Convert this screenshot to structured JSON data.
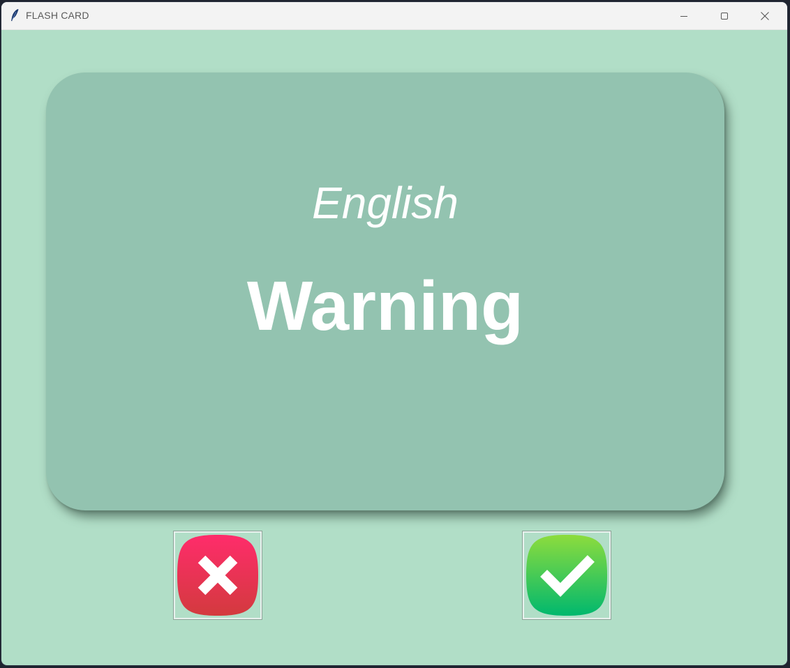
{
  "window": {
    "title": "FLASH CARD"
  },
  "card": {
    "language": "English",
    "word": "Warning"
  },
  "buttons": {
    "wrong_icon": "cross-icon",
    "right_icon": "check-icon"
  },
  "colors": {
    "background": "#b1dec7",
    "card": "#93c3b0",
    "wrong_top": "#ff2c6b",
    "wrong_bottom": "#d33a3e",
    "right_top": "#8ddc3d",
    "right_bottom": "#00b86e"
  }
}
